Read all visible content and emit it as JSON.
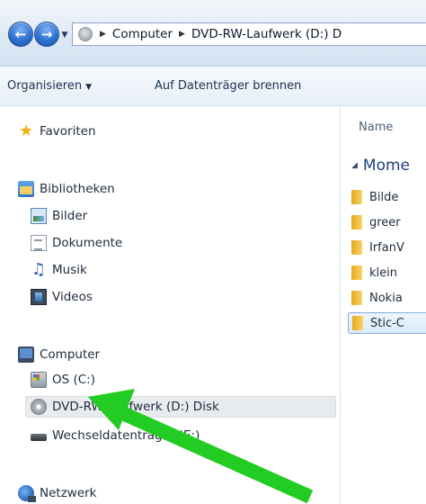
{
  "address_bar": {
    "crumbs": [
      "Computer",
      "DVD-RW-Laufwerk (D:) D"
    ]
  },
  "toolbar": {
    "organize_label": "Organisieren",
    "burn_label": "Auf Datenträger brennen"
  },
  "nav_tree": {
    "favorites": "Favoriten",
    "libraries": "Bibliotheken",
    "library_items": [
      "Bilder",
      "Dokumente",
      "Musik",
      "Videos"
    ],
    "computer": "Computer",
    "drives": [
      "OS (C:)",
      "DVD-RW-Laufwerk (D:) Disk",
      "Wechseldatenträger (E:)"
    ],
    "network": "Netzwerk"
  },
  "content": {
    "column_name": "Name",
    "group_title": "Mome",
    "files": [
      "Bilde",
      "greer",
      "IrfanV",
      "klein",
      "Nokia",
      "Stic-C"
    ]
  },
  "annotation": {
    "arrow_color": "#22cc22"
  },
  "colors": {
    "selection": "#e9ecef",
    "accent": "#1e3d7a"
  }
}
